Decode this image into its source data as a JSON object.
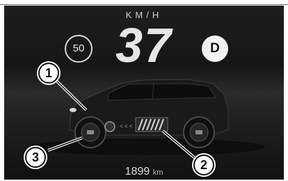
{
  "header": {
    "unit": "KM/H",
    "speed": "37"
  },
  "speed_limit": {
    "value": "50"
  },
  "gear": {
    "value": "D"
  },
  "odometer": {
    "value": "1899",
    "unit": "km"
  },
  "callouts": [
    "1",
    "2",
    "3"
  ],
  "arrow_glyphs": "< < <"
}
